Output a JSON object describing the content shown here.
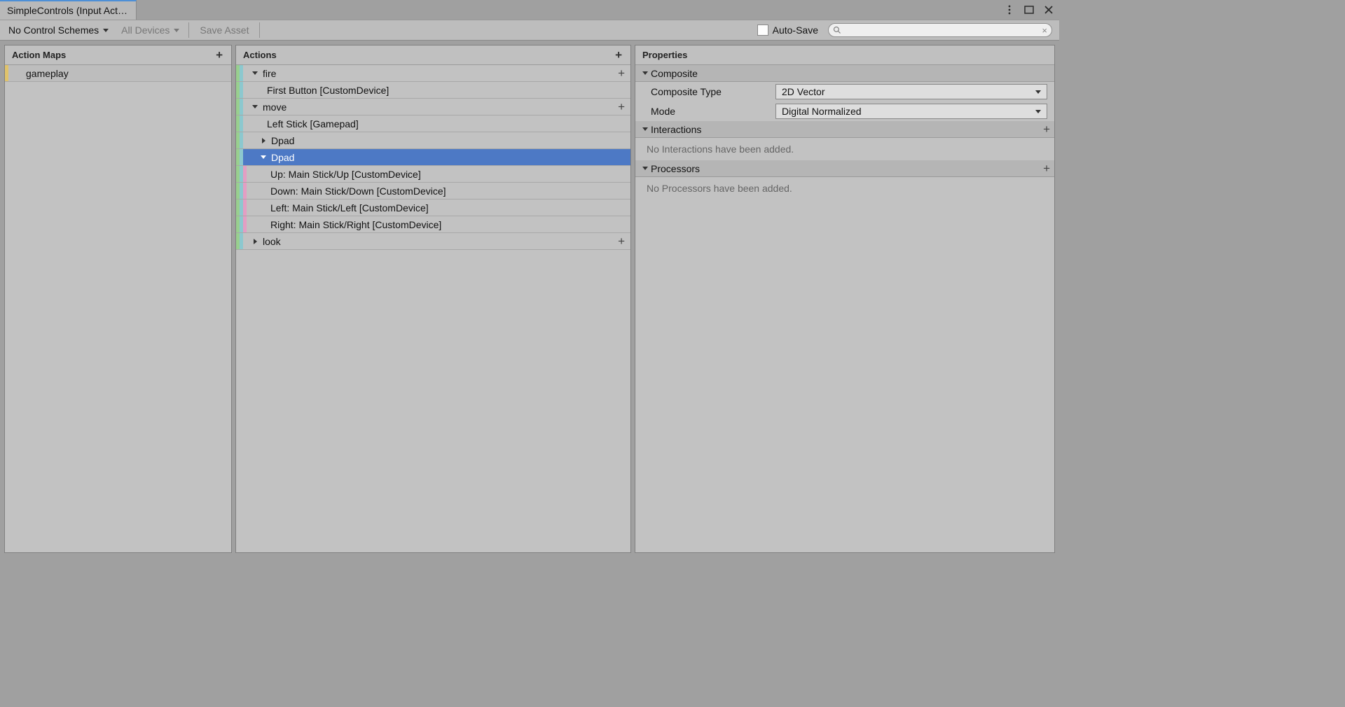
{
  "tab": {
    "title": "SimpleControls (Input Act…"
  },
  "toolbar": {
    "scheme_label": "No Control Schemes",
    "devices_label": "All Devices",
    "save_label": "Save Asset",
    "autosave_label": "Auto-Save"
  },
  "maps": {
    "header": "Action Maps",
    "items": [
      {
        "label": "gameplay",
        "color": "#e0c36b",
        "selected": true
      }
    ]
  },
  "actions": {
    "header": "Actions",
    "tree": {
      "fire": {
        "label": "fire",
        "binding0": "First Button [CustomDevice]"
      },
      "move": {
        "label": "move",
        "binding0": "Left Stick [Gamepad]",
        "dpad1": "Dpad",
        "dpad2": {
          "label": "Dpad",
          "up": "Up: Main Stick/Up [CustomDevice]",
          "down": "Down: Main Stick/Down [CustomDevice]",
          "left": "Left: Main Stick/Left [CustomDevice]",
          "right": "Right: Main Stick/Right [CustomDevice]"
        }
      },
      "look": {
        "label": "look"
      }
    }
  },
  "props": {
    "header": "Properties",
    "composite": {
      "title": "Composite",
      "type_label": "Composite Type",
      "type_value": "2D Vector",
      "mode_label": "Mode",
      "mode_value": "Digital Normalized"
    },
    "interactions": {
      "title": "Interactions",
      "empty": "No Interactions have been added."
    },
    "processors": {
      "title": "Processors",
      "empty": "No Processors have been added."
    }
  }
}
